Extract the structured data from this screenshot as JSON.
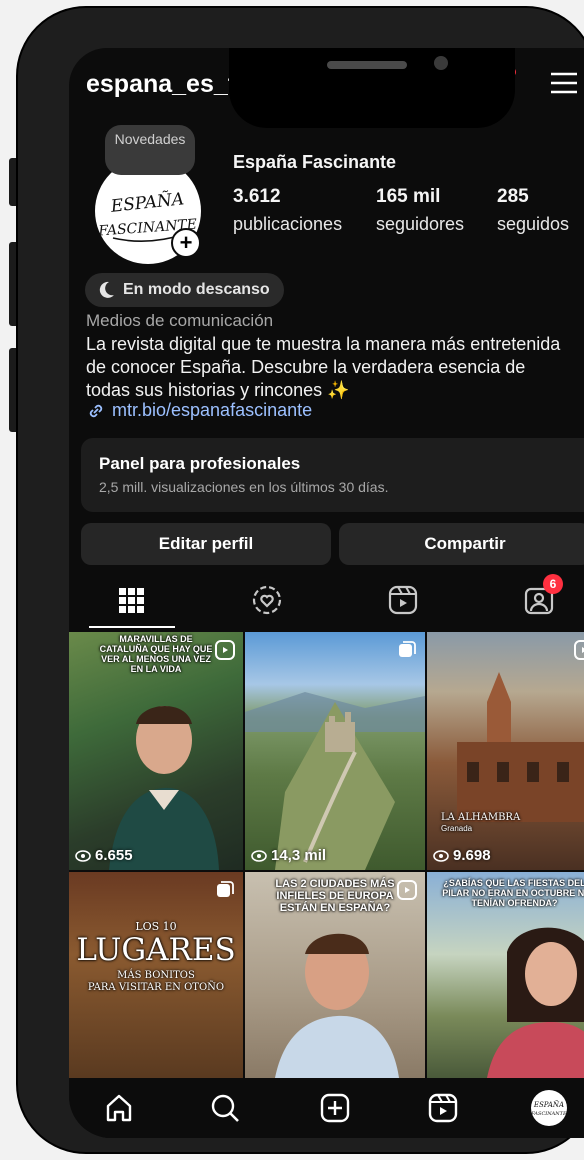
{
  "profile": {
    "username": "espana_es_fascinante",
    "note": "Novedades",
    "display_name": "España Fascinante",
    "avatar_text": "ESPAÑA FASCINANTE",
    "stats": [
      {
        "value": "3.612",
        "label": "publicaciones"
      },
      {
        "value": "165 mil",
        "label": "seguidores"
      },
      {
        "value": "285",
        "label": "seguidos"
      }
    ],
    "status": "En modo descanso",
    "category": "Medios de comunicación",
    "bio_lines": [
      "La revista digital que te muestra la manera más entretenida",
      "de conocer España. Descubre la verdadera esencia de",
      "todas sus historias y rincones ✨"
    ],
    "link": "mtr.bio/espanafascinante"
  },
  "pro_panel": {
    "title": "Panel para profesionales",
    "subtitle": "2,5 mill. visualizaciones en los últimos 30 días."
  },
  "actions": {
    "edit": "Editar perfil",
    "share": "Compartir"
  },
  "tabs": {
    "tagged_badge": "6"
  },
  "posts": [
    {
      "overlay": "MARAVILLAS DE CATALUÑA QUE HAY QUE VER AL MENOS UNA VEZ EN LA VIDA",
      "views": "6.655",
      "type": "reel"
    },
    {
      "overlay": "",
      "views": "14,3 mil",
      "type": "carousel"
    },
    {
      "overlay": "LA ALHAMBRA",
      "overlay_sub": "Granada",
      "views": "9.698",
      "type": "reel"
    },
    {
      "overlay_small": "LOS 10",
      "overlay": "LUGARES",
      "overlay_sub": "MÁS BONITOS\nPARA VISITAR EN OTOÑO",
      "type": "carousel"
    },
    {
      "overlay": "LAS 2 CIUDADES MÁS INFIELES DE EUROPA ESTÁN EN ESPAÑA?",
      "type": "reel"
    },
    {
      "overlay": "¿SABÍAS QUE LAS FIESTAS DEL PILAR NO ERAN EN OCTUBRE NI TENÍAN OFRENDA?",
      "type": "reel"
    }
  ],
  "colors": {
    "background": "#0c0c0c",
    "link": "#9cc0ff",
    "badge": "#ff3040"
  }
}
